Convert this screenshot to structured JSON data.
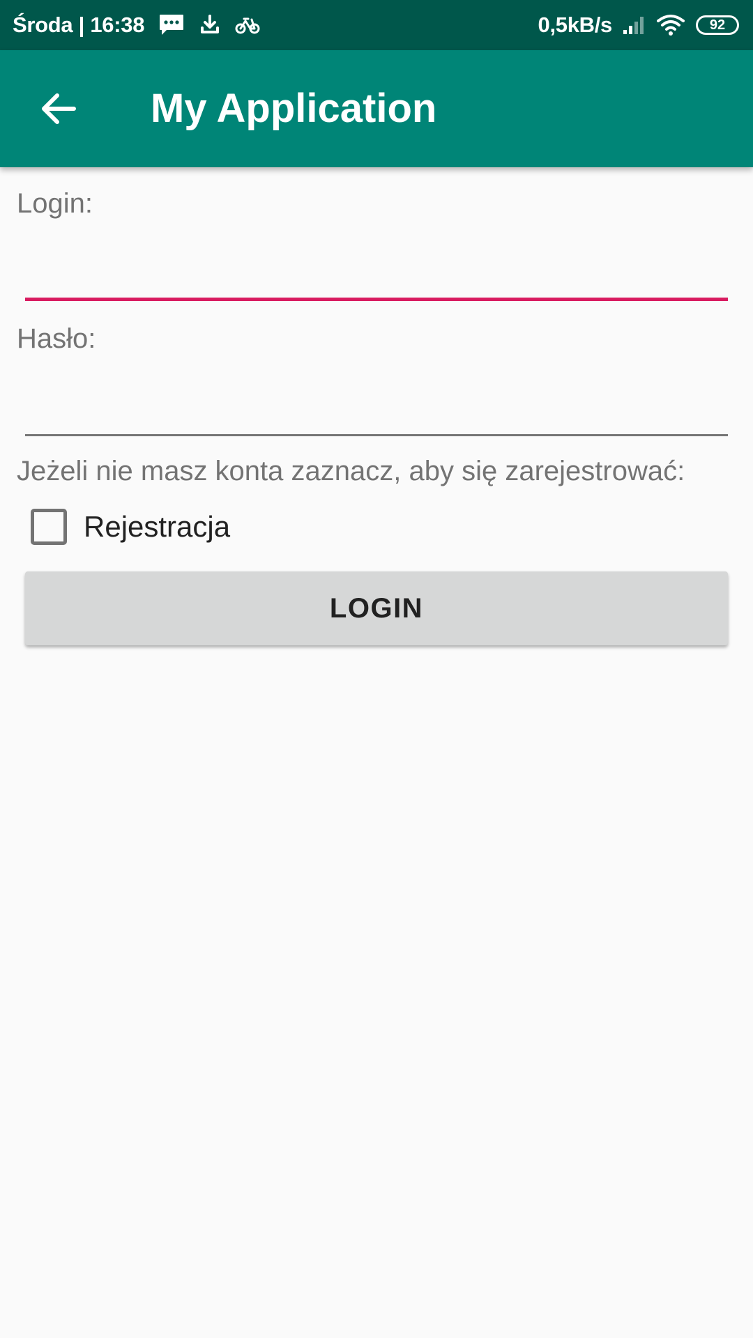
{
  "status_bar": {
    "day_time": "Środa | 16:38",
    "network_speed": "0,5kB/s",
    "battery_level": "92",
    "icons": [
      "message-icon",
      "download-icon",
      "bike-icon",
      "signal-icon",
      "wifi-icon",
      "battery-icon"
    ],
    "background_color": "#00574b"
  },
  "app_bar": {
    "title": "My Application",
    "back_icon": "arrow-back-icon",
    "background_color": "#008577"
  },
  "form": {
    "login_label": "Login:",
    "login_value": "",
    "password_label": "Hasło:",
    "password_value": "",
    "register_hint": "Jeżeli nie masz konta zaznacz, aby się zarejestrować:",
    "register_checkbox_label": "Rejestracja",
    "register_checked": false,
    "login_button_label": "LOGIN",
    "accent_color": "#d81b60"
  }
}
